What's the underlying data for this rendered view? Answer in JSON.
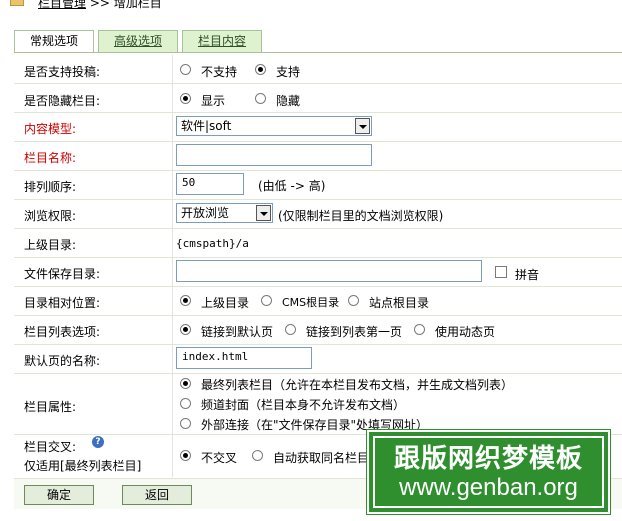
{
  "breadcrumb": {
    "parent": "栏目管理",
    "separator": ">>",
    "current": "增加栏目"
  },
  "tabs": [
    {
      "label": "常规选项",
      "active": true
    },
    {
      "label": "高级选项",
      "active": false
    },
    {
      "label": "栏目内容",
      "active": false
    }
  ],
  "rows": {
    "submit": {
      "label": "是否支持投稿:",
      "opt1": "不支持",
      "opt2": "支持"
    },
    "hidden": {
      "label": "是否隐藏栏目:",
      "opt1": "显示",
      "opt2": "隐藏"
    },
    "model": {
      "label": "内容模型:",
      "value": "软件|soft"
    },
    "name": {
      "label": "栏目名称:",
      "value": ""
    },
    "order": {
      "label": "排列顺序:",
      "value": "50",
      "hint": "(由低 -> 高)"
    },
    "perm": {
      "label": "浏览权限:",
      "value": "开放浏览",
      "hint": "(仅限制栏目里的文档浏览权限)"
    },
    "parent": {
      "label": "上级目录:",
      "value": "{cmspath}/a"
    },
    "savedir": {
      "label": "文件保存目录:",
      "value": "",
      "pinyin": "拼音"
    },
    "relpos": {
      "label": "目录相对位置:",
      "opt1": "上级目录",
      "opt2": "CMS根目录",
      "opt3": "站点根目录"
    },
    "listopt": {
      "label": "栏目列表选项:",
      "opt1": "链接到默认页",
      "opt2": "链接到列表第一页",
      "opt3": "使用动态页"
    },
    "defpage": {
      "label": "默认页的名称:",
      "value": "index.html"
    },
    "attr": {
      "label": "栏目属性:",
      "opt1": "最终列表栏目（允许在本栏目发布文档，并生成文档列表）",
      "opt2": "频道封面（栏目本身不允许发布文档）",
      "opt3": "外部连接（在\"文件保存目录\"处填写网址）"
    },
    "cross": {
      "label1": "栏目交叉:",
      "label2": "仅适用[最终列表栏目]",
      "opt1": "不交叉",
      "opt2": "自动获取同名栏目"
    }
  },
  "buttons": {
    "ok": "确定",
    "back": "返回"
  },
  "watermark": {
    "title": "跟版网织梦模板",
    "url": "www.genban.org"
  }
}
